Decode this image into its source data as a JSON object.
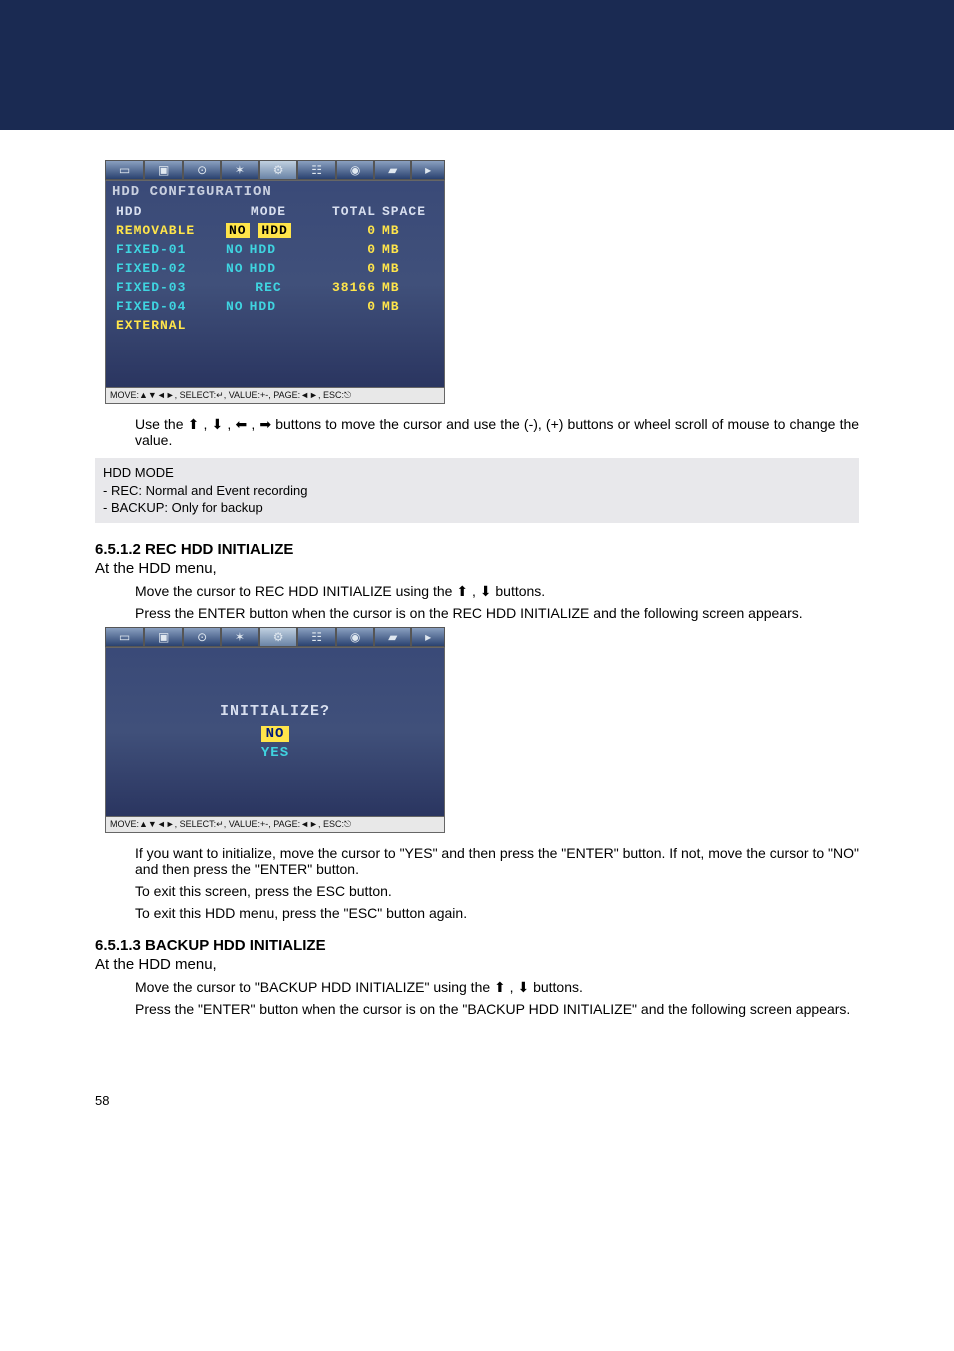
{
  "panel1": {
    "title": "HDD CONFIGURATION",
    "headers": {
      "hdd": "HDD",
      "mode": "MODE",
      "total": "TOTAL",
      "space": "SPACE"
    },
    "rows": [
      {
        "name": "REMOVABLE",
        "mode_no": "NO",
        "mode_hdd": "HDD",
        "mode_highlight": true,
        "name_color": "yellow",
        "total": "0",
        "unit": "MB"
      },
      {
        "name": "FIXED-01",
        "mode_no": "NO",
        "mode_hdd": "HDD",
        "mode_highlight": false,
        "name_color": "cyan",
        "total": "0",
        "unit": "MB"
      },
      {
        "name": "FIXED-02",
        "mode_no": "NO",
        "mode_hdd": "HDD",
        "mode_highlight": false,
        "name_color": "cyan",
        "total": "0",
        "unit": "MB"
      },
      {
        "name": "FIXED-03",
        "mode_no": "",
        "mode_hdd": "REC",
        "mode_highlight": false,
        "name_color": "cyan",
        "total": "38166",
        "unit": "MB"
      },
      {
        "name": "FIXED-04",
        "mode_no": "NO",
        "mode_hdd": "HDD",
        "mode_highlight": false,
        "name_color": "cyan",
        "total": "0",
        "unit": "MB"
      },
      {
        "name": "EXTERNAL",
        "mode_no": "",
        "mode_hdd": "",
        "mode_highlight": false,
        "name_color": "yellow",
        "total": "",
        "unit": ""
      }
    ],
    "footer": "MOVE:▲▼◄►, SELECT:↵, VALUE:+-, PAGE:◄►, ESC:⎋"
  },
  "para1a": "Use the ",
  "para1b": " buttons to move the cursor and use the (-), (+) buttons or wheel scroll of mouse to change the value.",
  "note": {
    "line1": "HDD MODE",
    "line2": "- REC: Normal and Event recording",
    "line3": "- BACKUP: Only for backup"
  },
  "sec6512_h": "6.5.1.2   REC HDD INITIALIZE",
  "at_menu": "At the HDD menu,",
  "sec6512_l1a": "Move the cursor to REC HDD INITIALIZE using the ",
  "sec6512_l1b": " buttons.",
  "sec6512_l2": "Press the ENTER button when the cursor is on the REC HDD INITIALIZE and the following screen appears.",
  "panel2": {
    "question": "INITIALIZE?",
    "no": "NO",
    "yes": "YES",
    "footer": "MOVE:▲▼◄►, SELECT:↵, VALUE:+-, PAGE:◄►, ESC:⎋"
  },
  "sec6512_l3": "If you want to initialize, move the cursor to \"YES\" and then press the \"ENTER\" button. If not, move the cursor to \"NO\" and then press the \"ENTER\" button.",
  "sec6512_l4": "To exit this screen, press the ESC button.",
  "sec6512_l5": "To exit this HDD menu, press the \"ESC\" button again.",
  "sec6513_h": "6.5.1.3   BACKUP HDD INITIALIZE",
  "sec6513_l1a": "Move the cursor to \"BACKUP HDD INITIALIZE\" using the ",
  "sec6513_l1b": " buttons.",
  "sec6513_l2": "Press the \"ENTER\" button when the cursor is on the \"BACKUP HDD INITIALIZE\" and the following screen appears.",
  "page_number": "58",
  "arrows": {
    "up": "⬆",
    "down": "⬇",
    "left": "⬅",
    "right": "➡"
  },
  "sep": " , "
}
